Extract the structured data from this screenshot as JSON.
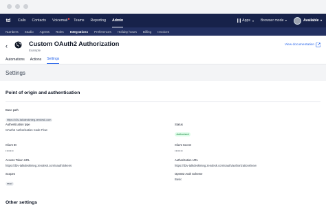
{
  "topnav": {
    "items": [
      "Calls",
      "Contacts",
      "Voicemail",
      "Teams",
      "Reporting",
      "Admin"
    ],
    "apps": "Apps",
    "browser_mode": "Browser mode",
    "status": "Available"
  },
  "subnav": {
    "items": [
      "Numbers",
      "Studio",
      "Agents",
      "Roles",
      "Integrations",
      "Preferences",
      "Holiday hours",
      "Billing",
      "Invoices"
    ]
  },
  "header": {
    "title": "Custom OAuth2 Authorization",
    "subtitle": "Example",
    "view_doc": "View documentation"
  },
  "tabs": [
    "Automations",
    "Actions",
    "Settings"
  ],
  "settings_heading": "Settings",
  "section1": {
    "title": "Point of origin and authentication",
    "base_path_label": "Base path",
    "base_path_value": "https://d3v-talkdeskinteg.zendesk.com",
    "auth_type_label": "Authentication type",
    "auth_type_value": "OAuth2 Authorization Code Flow",
    "status_label": "Status",
    "status_value": "Authorized",
    "client_id_label": "Client ID",
    "client_id_value": "•••••••",
    "client_secret_label": "Client Secret",
    "client_secret_value": "•••••••",
    "access_token_label": "Access Token URL",
    "access_token_value": "https://d3v-talkdeskinteg.zendesk.com/oauth/tokens",
    "auth_url_label": "Authorization URL",
    "auth_url_value": "https://d3v-talkdeskinteg.zendesk.com/oauth/authorizations/new",
    "scopes_label": "Scopes",
    "scopes_value": "read",
    "openid_label": "OpenID Auth Scheme",
    "openid_value": "Basic"
  },
  "section2": {
    "title": "Other settings"
  }
}
